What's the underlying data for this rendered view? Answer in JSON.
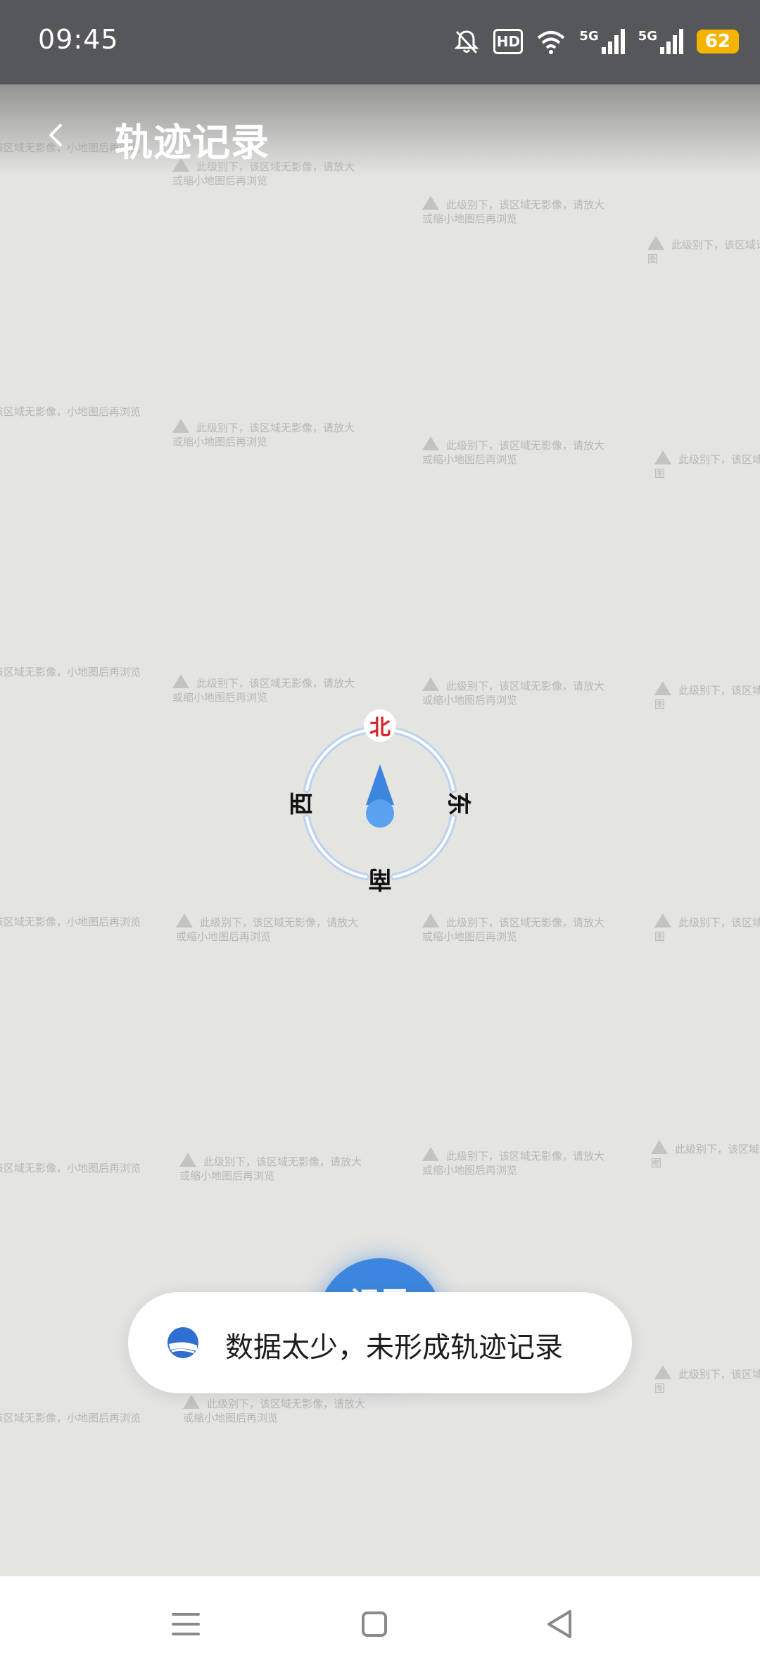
{
  "status_bar": {
    "time": "09:45",
    "hd_label": "HD",
    "signal_1_label": "5G",
    "signal_2_label": "5G",
    "battery_level": "62",
    "icons": [
      "bell-muted-icon",
      "hd-icon",
      "wifi-icon",
      "signal-5g-icon",
      "signal-5g-icon",
      "battery-icon"
    ]
  },
  "header": {
    "title": "轨迹记录",
    "back_icon": "chevron-left-icon"
  },
  "map": {
    "tile_notice": "此级别下，该区域无影像，请放大或缩小地图后再浏览",
    "tile_notice_partial_left": "该区域无影像，小地图后再浏览",
    "tile_notice_partial_right": "此级别下，该区域请放大或缩小地图"
  },
  "compass": {
    "north": "北",
    "east": "东",
    "south": "南",
    "west": "西"
  },
  "record_button": {
    "label": "记录"
  },
  "toast": {
    "message": "数据太少，未形成轨迹记录",
    "icon": "app-logo-icon"
  },
  "nav_bar": {
    "icons": [
      "menu-icon",
      "home-square-icon",
      "back-triangle-icon"
    ]
  },
  "colors": {
    "status_bar_bg": "#56575b",
    "map_bg": "#e4e4e1",
    "accent_blue": "#3d86e0",
    "north_red": "#d9262c",
    "battery": "#f4b400"
  }
}
